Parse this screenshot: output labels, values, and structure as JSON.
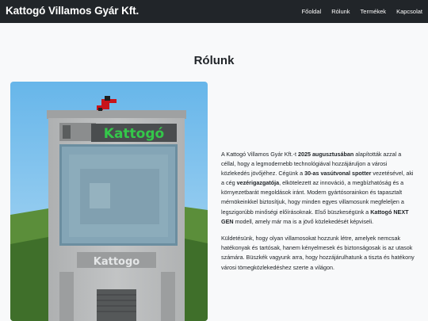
{
  "brand": "Kattogó Villamos Gyár Kft.",
  "nav": {
    "home": "Főoldal",
    "about": "Rólunk",
    "products": "Termékek",
    "contact": "Kapcsolat"
  },
  "page_title": "Rólunk",
  "hero": {
    "top_sign": "Kattogó",
    "side_sign": "Kattogo"
  },
  "p1": {
    "t1": "A Kattogó Villamos Gyár Kft.-t ",
    "b1": "2025 augusztusában",
    "t2": " alapították azzal a céllal, hogy a legmodernebb technológiával hozzájáruljon a városi közlekedés jövőjéhez. Cégünk a ",
    "b2": "30-as vasútvonal spotter",
    "t3": " vezetésével, aki a cég ",
    "b3": "vezérigazgatója",
    "t4": ", elkötelezett az innováció, a megbízhatóság és a környezetbarát megoldások iránt. Modern gyártósorainkon és tapasztalt mérnökeinkkel biztosítjuk, hogy minden egyes villamosunk megfeleljen a legszigorúbb minőségi előírásoknak. Első büszkeségünk a ",
    "b4": "Kattogó NEXT GEN",
    "t5": " modell, amely már ma is a jövő közlekedését képviseli."
  },
  "p2": "Küldetésünk, hogy olyan villamosokat hozzunk létre, amelyek nemcsak hatékonyak és tartósak, hanem kényelmesek és biztonságosak is az utasok számára. Büszkék vagyunk arra, hogy hozzájárulhatunk a tiszta és hatékony városi tömegközlekedéshez szerte a világon.",
  "colors": {
    "navbar": "#212529",
    "sign_green": "#34c84a"
  }
}
